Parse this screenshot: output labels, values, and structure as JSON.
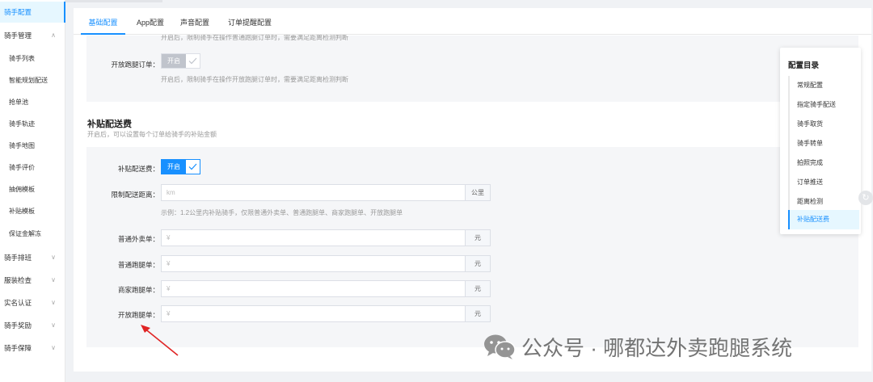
{
  "sidebar": {
    "items": [
      {
        "label": "骑手配置",
        "arrow": ""
      },
      {
        "label": "骑手管理",
        "arrow": "∧"
      },
      {
        "label": "骑手列表",
        "arrow": ""
      },
      {
        "label": "智能规划配送",
        "arrow": ""
      },
      {
        "label": "抢单池",
        "arrow": ""
      },
      {
        "label": "骑手轨迹",
        "arrow": ""
      },
      {
        "label": "骑手地图",
        "arrow": ""
      },
      {
        "label": "骑手评价",
        "arrow": ""
      },
      {
        "label": "抽佣模板",
        "arrow": ""
      },
      {
        "label": "补贴模板",
        "arrow": ""
      },
      {
        "label": "保证金解冻",
        "arrow": ""
      },
      {
        "label": "骑手排班",
        "arrow": "∨"
      },
      {
        "label": "服装检查",
        "arrow": "∨"
      },
      {
        "label": "实名认证",
        "arrow": "∨"
      },
      {
        "label": "骑手奖励",
        "arrow": "∨"
      },
      {
        "label": "骑手保障",
        "arrow": "∨"
      }
    ]
  },
  "tabs": [
    "基础配置",
    "App配置",
    "声音配置",
    "订单提醒配置"
  ],
  "top_section": {
    "cut_note": "开启后，限制骑手在操作普通跑腿订单时，需要满足距离检测判断",
    "label": "开放跑腿订单：",
    "toggle_label": "开启",
    "note": "开启后，限制骑手在操作开放跑腿订单时，需要满足距离检测判断"
  },
  "subsidy": {
    "title": "补贴配送费",
    "desc": "开启后，可以设置每个订单给骑手的补贴金额",
    "toggle_row": {
      "label": "补贴配送费：",
      "toggle_label": "开启"
    },
    "distance_row": {
      "label": "限制配送距离：",
      "placeholder": "km",
      "suffix": "公里"
    },
    "example": "示例：1.2公里内补贴骑手，仅限普通外卖单、普通跑腿单、商家跑腿单、开放跑腿单",
    "rows": [
      {
        "label": "普通外卖单：",
        "placeholder": "¥",
        "suffix": "元"
      },
      {
        "label": "普通跑腿单：",
        "placeholder": "¥",
        "suffix": "元"
      },
      {
        "label": "商家跑腿单：",
        "placeholder": "¥",
        "suffix": "元"
      },
      {
        "label": "开放跑腿单：",
        "placeholder": "¥",
        "suffix": "元"
      }
    ]
  },
  "toc": {
    "title": "配置目录",
    "items": [
      "常规配置",
      "指定骑手配送",
      "骑手取货",
      "骑手转单",
      "拍照完成",
      "订单推送",
      "距离检测",
      "补贴配送费"
    ]
  },
  "watermark": {
    "text": "公众号 · 哪都达外卖跑腿系统"
  },
  "colors": {
    "accent": "#1890ff",
    "toggle_disabled": "#c0c4cc",
    "arrow": "#e02424"
  }
}
